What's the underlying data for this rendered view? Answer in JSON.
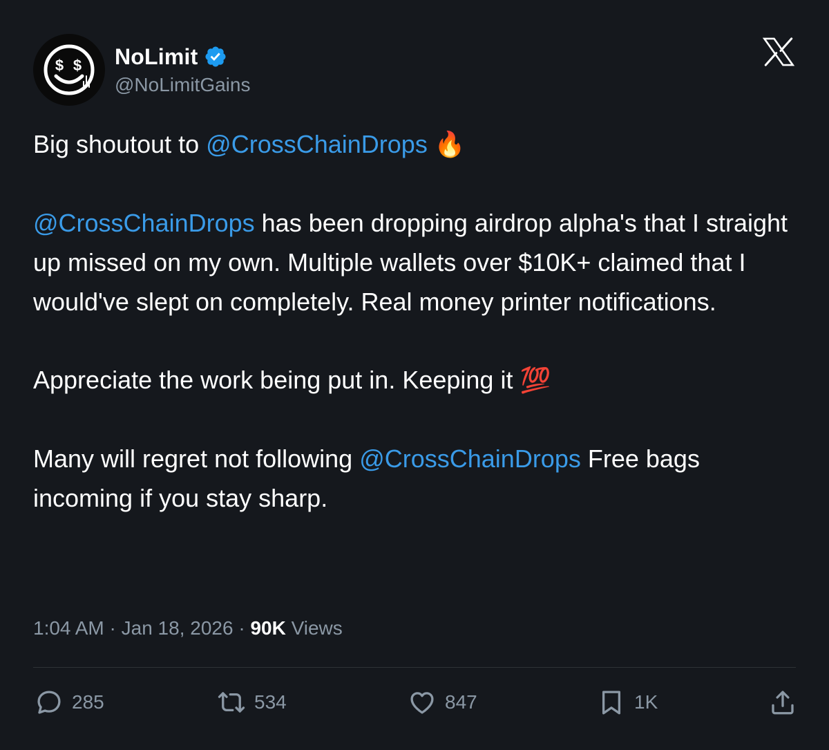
{
  "author": {
    "display_name": "NoLimit",
    "handle": "@NoLimitGains",
    "verified": true,
    "avatar_icon": "dollar-smiley-icon"
  },
  "brand_icon": "x-logo-icon",
  "tweet": {
    "p1_text": "Big shoutout to ",
    "p1_mention": "@CrossChainDrops",
    "p1_emoji": "🔥",
    "p2_mention": "@CrossChainDrops",
    "p2_text": " has been dropping airdrop alpha's that I straight up missed on my own. Multiple wallets over $10K+ claimed that I would've slept on completely. Real money printer notifications.",
    "p3_text": "Appreciate the work being put in. Keeping it ",
    "p3_emoji": "💯",
    "p4_text_a": "Many will regret not following ",
    "p4_mention": "@CrossChainDrops",
    "p4_text_b": " Free bags incoming if you stay sharp."
  },
  "meta": {
    "time": "1:04 AM",
    "sep1": " · ",
    "date": "Jan 18, 2026",
    "sep2": " · ",
    "views_count": "90K",
    "views_label": " Views"
  },
  "actions": {
    "replies": "285",
    "reposts": "534",
    "likes": "847",
    "bookmarks": "1K"
  },
  "colors": {
    "background": "#15181d",
    "mention": "#3a9be8",
    "verified": "#1d9bf0",
    "muted": "#8b98a5"
  }
}
